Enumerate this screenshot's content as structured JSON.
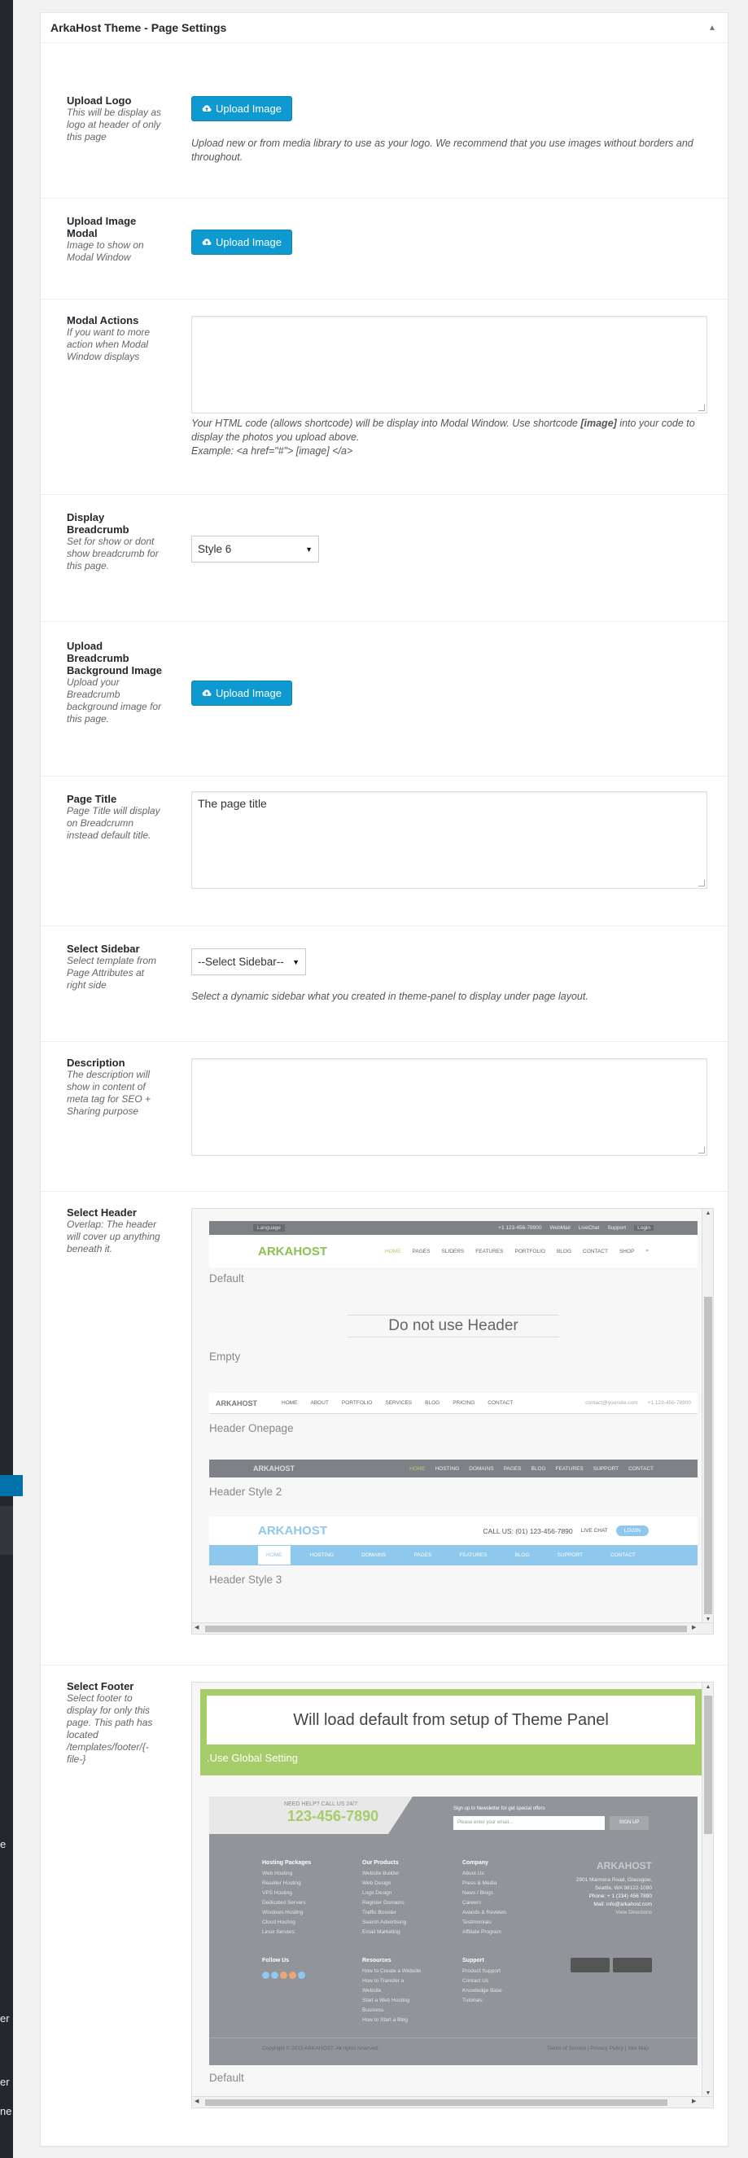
{
  "sidebar": {
    "fragments": [
      "e",
      "er",
      "er",
      "ne"
    ]
  },
  "metabox": {
    "title": "ArkaHost Theme - Page Settings"
  },
  "fields": {
    "upload_logo": {
      "label": "Upload Logo",
      "desc": "This will be display as logo at header of only this page",
      "button": "Upload Image",
      "help": "Upload new or from media library to use as your logo. We recommend that you use images without borders and throughout."
    },
    "upload_modal": {
      "label": "Upload Image Modal",
      "desc": "Image to show on Modal Window",
      "button": "Upload Image"
    },
    "modal_actions": {
      "label": "Modal Actions",
      "desc": "If you want to more action when Modal Window displays",
      "value": "",
      "help_1": "Your HTML code (allows shortcode) will be display into Modal Window. Use shortcode ",
      "help_bold": "[image]",
      "help_2": " into your code to display the photos you upload above.",
      "help_example": "Example: <a href=\"#\"> [image] </a>"
    },
    "breadcrumb": {
      "label": "Display Breadcrumb",
      "desc": "Set for show or dont show breadcrumb for this page.",
      "selected": "Style 6"
    },
    "breadcrumb_bg": {
      "label": "Upload Breadcrumb Background Image",
      "desc": "Upload your Breadcrumb background image for this page.",
      "button": "Upload Image"
    },
    "page_title": {
      "label": "Page Title",
      "desc": "Page Title will display on Breadcrumn instead default title.",
      "value": "The page title"
    },
    "sidebar": {
      "label": "Select Sidebar",
      "desc": "Select template from Page Attributes at right side",
      "selected": "--Select Sidebar--",
      "help": "Select a dynamic sidebar what you created in theme-panel to display under page layout."
    },
    "description": {
      "label": "Description",
      "desc": "The description will show in content of meta tag for SEO + Sharing purpose",
      "value": ""
    },
    "header": {
      "label": "Select Header",
      "desc": "Overlap: The header will cover up anything beneath it.",
      "options": [
        {
          "caption": "Default",
          "topbar": [
            "Language",
            "+1 123-456-78900",
            "WebMail",
            "LiveChat",
            "Support",
            "Login"
          ],
          "logo": "ARKAHOST",
          "nav": [
            "HOME",
            "PAGES",
            "SLIDERS",
            "FEATURES",
            "PORTFOLIO",
            "BLOG",
            "CONTACT",
            "SHOP"
          ]
        },
        {
          "caption": "Empty",
          "text": "Do not use Header"
        },
        {
          "caption": "Header Onepage",
          "logo": "ARKAHOST",
          "nav": [
            "HOME",
            "ABOUT",
            "PORTFOLIO",
            "SERVICES",
            "BLOG",
            "PRICING",
            "CONTACT"
          ],
          "extra": [
            "contact@yoursite.com",
            "+1 123-456-78900"
          ]
        },
        {
          "caption": "Header Style 2",
          "logo": "ARKAHOST",
          "nav": [
            "HOME",
            "HOSTING",
            "DOMAINS",
            "PAGES",
            "BLOG",
            "FEATURES",
            "SUPPORT",
            "CONTACT"
          ]
        },
        {
          "caption": "Header Style 3",
          "logo": "ARKAHOST",
          "call": "CALL US: (01) 123-456-7890",
          "chat": "LIVE CHAT",
          "login": "LOGIN",
          "nav": [
            "HOME",
            "HOSTING",
            "DOMAINS",
            "PAGES",
            "FEATURES",
            "BLOG",
            "SUPPORT",
            "CONTACT"
          ]
        }
      ]
    },
    "footer": {
      "label": "Select Footer",
      "desc": "Select footer to display for only this page. This path has located /templates/footer/{-file-}",
      "global": {
        "text": "Will load default from setup of Theme Panel",
        "caption": ".Use Global Setting"
      },
      "default": {
        "caption": "Default",
        "need_help": "NEED HELP? CALL US 24/7:",
        "phone": "123-456-7890",
        "newsletter": "Sign up to Newsletter for get special offers",
        "email_placeholder": "Please enter your email...",
        "signup": "SIGN UP",
        "columns": [
          {
            "title": "Hosting Packages",
            "items": [
              "Web Hosting",
              "Reseller Hosting",
              "VPS Hosting",
              "Dedicated Servers",
              "Windows Hosting",
              "Cloud Hosting",
              "Linux Servers"
            ]
          },
          {
            "title": "Our Products",
            "items": [
              "Website Builder",
              "Web Design",
              "Logo Design",
              "Register Domains",
              "Traffic Booster",
              "Search Advertising",
              "Email Marketing"
            ]
          },
          {
            "title": "Company",
            "items": [
              "About Us",
              "Press & Media",
              "News / Blogs",
              "Careers",
              "Awards & Reviews",
              "Testimonials",
              "Affiliate Program"
            ]
          }
        ],
        "follow": "Follow Us",
        "resources": {
          "title": "Resources",
          "items": [
            "How to Create a Website",
            "How to Transfer a Website",
            "Start a Web Hosting Business",
            "How to Start a Blog"
          ]
        },
        "support": {
          "title": "Support",
          "items": [
            "Product Support",
            "Contact Us",
            "Knowledge Base",
            "Tutorials"
          ]
        },
        "address": [
          "2901 Marmora Road, Glassgow,",
          "Seattle, WA 98122-1090",
          "Phone: + 1 (234) 456 7890",
          "Mail: info@arkahost.com",
          "View Directions"
        ],
        "copyright": "Copyright © 2015 ARKAHOST. All rights reserved.",
        "legal": "Terms of Service | Privacy Policy | Site Map"
      }
    }
  },
  "colors": {
    "accent": "#0e9ad1",
    "green": "#a5cd6a",
    "footer_bg": "#919599",
    "header_dark": "#7e8186",
    "nav_blue": "#8ec8ec"
  }
}
